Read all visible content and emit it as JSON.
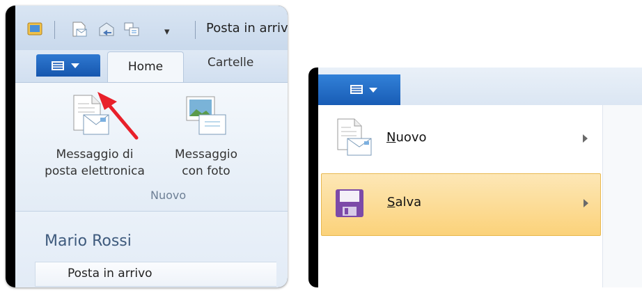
{
  "left_panel": {
    "title": "Posta in arriv",
    "qat_dropdown": "▾",
    "tabs": {
      "home": "Home",
      "cartelle": "Cartelle"
    },
    "ribbon": {
      "btn_email_line1": "Messaggio di",
      "btn_email_line2": "posta elettronica",
      "btn_photo_line1": "Messaggio",
      "btn_photo_line2": "con foto",
      "group_label": "Nuovo"
    },
    "nav": {
      "user": "Mario Rossi",
      "folder": "Posta in arrivo"
    }
  },
  "right_panel": {
    "menu": [
      {
        "accel": "N",
        "rest": "uovo"
      },
      {
        "accel": "S",
        "rest": "alva"
      }
    ]
  },
  "colors": {
    "file_tab": "#1656ae",
    "selection": "#fbd27a",
    "arrow": "#e8202a"
  }
}
